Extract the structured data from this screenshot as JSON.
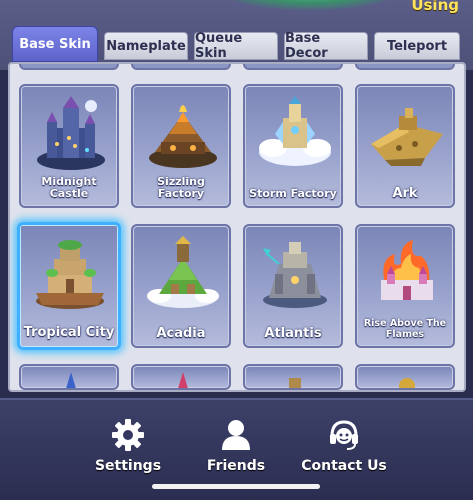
{
  "header": {
    "using_label": "Using"
  },
  "tabs": [
    {
      "label": "Base Skin",
      "active": true
    },
    {
      "label": "Nameplate",
      "active": false
    },
    {
      "label": "Queue Skin",
      "active": false
    },
    {
      "label": "Base Decor",
      "active": false
    },
    {
      "label": "Teleport",
      "active": false
    }
  ],
  "skins": [
    {
      "name": "Midnight Castle",
      "icon": "midnight-castle-icon",
      "selected": false
    },
    {
      "name": "Sizzling Factory",
      "icon": "sizzling-factory-icon",
      "selected": false
    },
    {
      "name": "Storm Factory",
      "icon": "storm-factory-icon",
      "selected": false
    },
    {
      "name": "Ark",
      "icon": "ark-icon",
      "selected": false
    },
    {
      "name": "Tropical City",
      "icon": "tropical-city-icon",
      "selected": true
    },
    {
      "name": "Acadia",
      "icon": "acadia-icon",
      "selected": false
    },
    {
      "name": "Atlantis",
      "icon": "atlantis-icon",
      "selected": false
    },
    {
      "name": "Rise Above The Flames",
      "icon": "rise-above-the-flames-icon",
      "selected": false
    }
  ],
  "bottom_nav": [
    {
      "label": "Settings",
      "icon": "gear-icon"
    },
    {
      "label": "Friends",
      "icon": "person-icon"
    },
    {
      "label": "Contact Us",
      "icon": "headset-icon"
    }
  ],
  "colors": {
    "active_tab": "#6a70d8",
    "selected_border": "#3fb0ff",
    "using_text": "#ffe35a",
    "nav_background": "#2f3256"
  }
}
